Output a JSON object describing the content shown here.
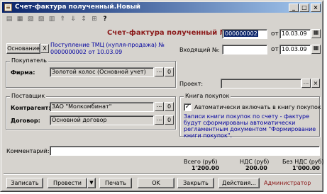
{
  "window": {
    "title": "Счет-фактура полученный.Новый",
    "controls": {
      "minimize": "_",
      "maximize": "□",
      "close": "×"
    }
  },
  "toolbar": {
    "icons": [
      "new-doc-icon",
      "copy-doc-icon",
      "edit-doc-icon",
      "delete-doc-icon",
      "list-icon",
      "up-icon",
      "down-icon",
      "sort-icon",
      "structure-icon",
      "help-icon"
    ],
    "glyphs": [
      "▤",
      "▦",
      "▧",
      "▨",
      "▥",
      "⇑",
      "⇓",
      "↕",
      "⊞",
      "?"
    ]
  },
  "header": {
    "doc_title": "Счет-фактура полученный №",
    "number": "000000002",
    "from_label": "от",
    "date": "10.03.09",
    "incoming_label": "Входящий №:",
    "incoming_number": "",
    "incoming_from_label": "от",
    "incoming_date": "10.03.09"
  },
  "basis": {
    "button_label": "Основание",
    "clear_label": "X",
    "text_line1": "Поступление ТМЦ (купля-продажа) №",
    "text_line2": "0000000002 от 10.03.09"
  },
  "buyer": {
    "group_title": "Покупатель",
    "firm_label": "Фирма:",
    "firm_value": "Золотой колос (Основной учет)",
    "select_label": "...",
    "open_label": "0"
  },
  "project": {
    "label": "Проект:",
    "value": "",
    "select_label": "...",
    "clear_label": "×"
  },
  "supplier": {
    "group_title": "Поставщик",
    "counterparty_label": "Контрагент:",
    "counterparty_value": "ЗАО \"Молкомбинат\"",
    "contract_label": "Договор:",
    "contract_value": "Основной договор",
    "select_label": "...",
    "open_label": "0"
  },
  "purchase_book": {
    "group_title": "Книга покупок",
    "auto_include_label": "Автоматически включать в книгу покупок",
    "auto_include_checked": true,
    "info_text": "Записи книги покупок по счету - фактуре будут сформированы автоматически регламентным документом \"Формирование книги покупок\"."
  },
  "comment": {
    "label": "Комментарий:",
    "value": ""
  },
  "totals": {
    "total_label": "Всего (руб)",
    "total_value": "1'200.00",
    "vat_label": "НДС (руб)",
    "vat_value": "200.00",
    "no_vat_label": "Без НДС (руб)",
    "no_vat_value": "1'000.00"
  },
  "footer": {
    "write_label": "Записать",
    "post_label": "Провести",
    "post_menu_label": "▼",
    "print_label": "Печать",
    "ok_label": "OK",
    "close_label": "Закрыть",
    "actions_label": "Действия...",
    "user": "Администратор"
  }
}
